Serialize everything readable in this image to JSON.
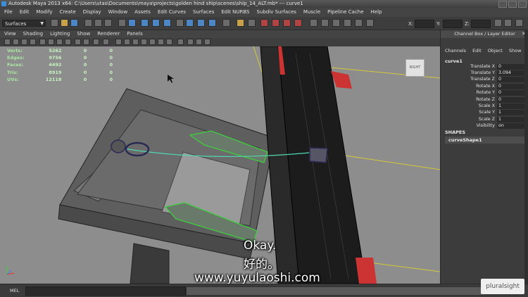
{
  "window": {
    "title": "Autodesk Maya 2013 x64: C:\\Users\\utas\\Documents\\maya\\projects\\golden hind ship\\scenes\\ship_14_ALT.mb*   ---   curve1"
  },
  "menubar": [
    "File",
    "Edit",
    "Modify",
    "Create",
    "Display",
    "Window",
    "Assets",
    "Edit Curves",
    "Surfaces",
    "Edit NURBS",
    "Subdiv Surfaces",
    "Muscle",
    "Pipeline Cache",
    "Help"
  ],
  "statusline": {
    "mode": "Surfaces",
    "x_label": "X:",
    "y_label": "Y:",
    "z_label": "Z:"
  },
  "panel_menu": [
    "View",
    "Shading",
    "Lighting",
    "Show",
    "Renderer",
    "Panels"
  ],
  "hud": [
    {
      "label": "Verts:",
      "v1": "5262",
      "v2": "0",
      "v3": "0"
    },
    {
      "label": "Edges:",
      "v1": "9756",
      "v2": "0",
      "v3": "0"
    },
    {
      "label": "Faces:",
      "v1": "4492",
      "v2": "0",
      "v3": "0"
    },
    {
      "label": "Tris:",
      "v1": "8919",
      "v2": "0",
      "v3": "0"
    },
    {
      "label": "UVs:",
      "v1": "12118",
      "v2": "0",
      "v3": "0"
    }
  ],
  "viewcube": {
    "face_label": "RIGHT"
  },
  "channel_box": {
    "title": "Channel Box / Layer Editor",
    "menu": [
      "Channels",
      "Edit",
      "Object",
      "Show"
    ],
    "node": "curve1",
    "attributes": [
      {
        "name": "Translate X",
        "value": "0"
      },
      {
        "name": "Translate Y",
        "value": "3.094"
      },
      {
        "name": "Translate Z",
        "value": "0"
      },
      {
        "name": "Rotate X",
        "value": "0"
      },
      {
        "name": "Rotate Y",
        "value": "0"
      },
      {
        "name": "Rotate Z",
        "value": "0"
      },
      {
        "name": "Scale X",
        "value": "1"
      },
      {
        "name": "Scale Y",
        "value": "1"
      },
      {
        "name": "Scale Z",
        "value": "1"
      },
      {
        "name": "Visibility",
        "value": "on"
      }
    ],
    "shapes_header": "SHAPES",
    "shape_item": "curveShape1"
  },
  "subtitles": {
    "line1": "Okay.",
    "line2": "好的。",
    "watermark": "www.yuyulaoshi.com"
  },
  "bottom": {
    "mel_label": "MEL",
    "logo": "pluralsight"
  },
  "colors": {
    "viewport_bg": "#8d8d8d",
    "selection_green": "#3ecf3e",
    "curve_cyan": "#4fd8b0",
    "mast_dark": "#1c1c1c"
  }
}
